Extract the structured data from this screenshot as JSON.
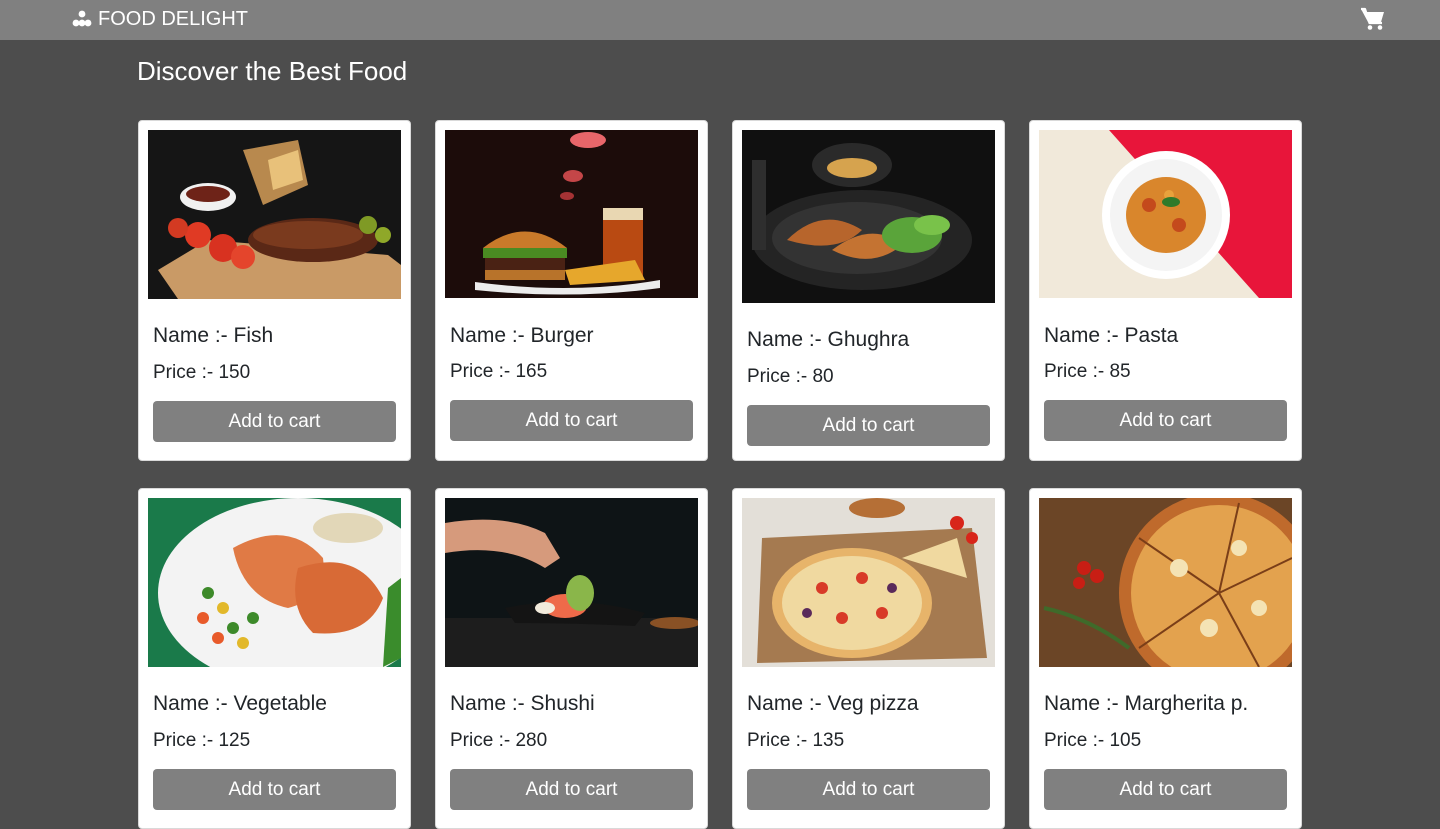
{
  "nav": {
    "brand": "FOOD DELIGHT",
    "brand_icon": "sitemap-icon",
    "cart_icon": "shopping-cart-icon"
  },
  "page": {
    "heading": "Discover the Best Food"
  },
  "products": [
    {
      "name": "Name :- Fish",
      "price": "Price :- 150",
      "button": "Add to cart"
    },
    {
      "name": "Name :- Burger",
      "price": "Price :- 165",
      "button": "Add to cart"
    },
    {
      "name": "Name :- Ghughra",
      "price": "Price :- 80",
      "button": "Add to cart"
    },
    {
      "name": "Name :- Pasta",
      "price": "Price :- 85",
      "button": "Add to cart"
    },
    {
      "name": "Name :- Vegetable",
      "price": "Price :- 125",
      "button": "Add to cart"
    },
    {
      "name": "Name :- Shushi",
      "price": "Price :- 280",
      "button": "Add to cart"
    },
    {
      "name": "Name :- Veg pizza",
      "price": "Price :- 135",
      "button": "Add to cart"
    },
    {
      "name": "Name :- Margherita p.",
      "price": "Price :- 105",
      "button": "Add to cart"
    }
  ]
}
